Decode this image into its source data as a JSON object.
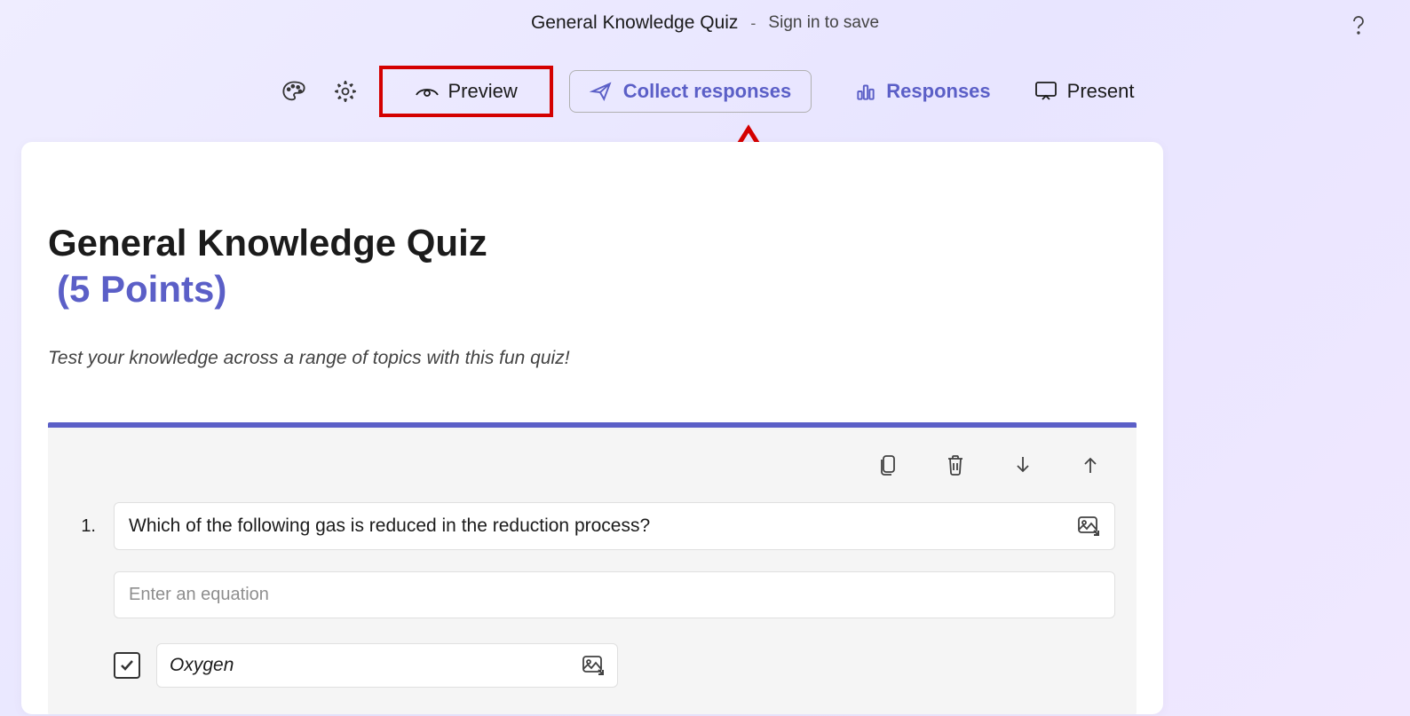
{
  "header": {
    "title": "General Knowledge Quiz",
    "separator": "-",
    "signin": "Sign in to save"
  },
  "toolbar": {
    "preview": "Preview",
    "collect": "Collect responses",
    "responses": "Responses",
    "present": "Present"
  },
  "form": {
    "title": "General Knowledge Quiz",
    "points": "(5 Points)",
    "description": "Test your knowledge across a range of topics with this fun quiz!"
  },
  "question": {
    "number": "1.",
    "text": "Which of the following gas is reduced in the reduction process?",
    "equation_placeholder": "Enter an equation",
    "options": [
      {
        "label": "Oxygen",
        "checked": true
      }
    ]
  },
  "annotation": {
    "highlight_color": "#d40000"
  }
}
